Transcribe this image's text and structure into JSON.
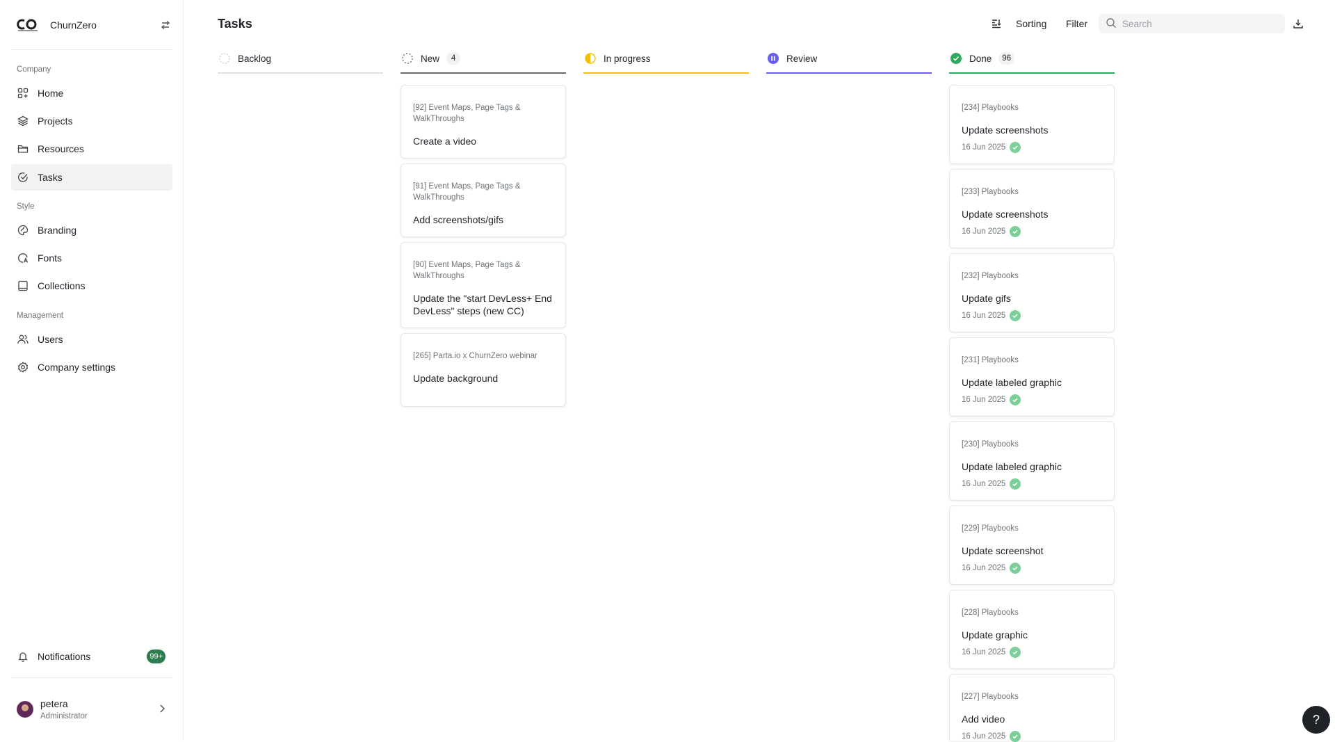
{
  "brand": {
    "name": "ChurnZero"
  },
  "sidebar": {
    "sections": {
      "company": "Company",
      "style": "Style",
      "management": "Management"
    },
    "items": [
      {
        "label": "Home",
        "icon": "home-icon"
      },
      {
        "label": "Projects",
        "icon": "stack-icon"
      },
      {
        "label": "Resources",
        "icon": "folder-icon"
      },
      {
        "label": "Tasks",
        "icon": "check-circle-icon",
        "active": true
      },
      {
        "label": "Branding",
        "icon": "palette-icon"
      },
      {
        "label": "Fonts",
        "icon": "font-icon"
      },
      {
        "label": "Collections",
        "icon": "book-icon"
      },
      {
        "label": "Users",
        "icon": "users-icon"
      },
      {
        "label": "Company settings",
        "icon": "gear-icon"
      }
    ],
    "notifications": {
      "label": "Notifications",
      "badge": "99+"
    },
    "user": {
      "name": "petera",
      "role": "Administrator"
    }
  },
  "header": {
    "title": "Tasks",
    "sorting_label": "Sorting",
    "filter_label": "Filter",
    "search_placeholder": "Search"
  },
  "columns": [
    {
      "name": "Backlog",
      "count": "",
      "color": "#e0e0e0"
    },
    {
      "name": "New",
      "count": "4",
      "color": "#6b6b6b"
    },
    {
      "name": "In progress",
      "count": "",
      "color": "#f0c000"
    },
    {
      "name": "Review",
      "count": "",
      "color": "#6b5cf0"
    },
    {
      "name": "Done",
      "count": "96",
      "color": "#2ea85a"
    }
  ],
  "new_cards": [
    {
      "project": "[92] Event Maps, Page Tags & WalkThroughs",
      "title": "Create a video"
    },
    {
      "project": "[91] Event Maps, Page Tags & WalkThroughs",
      "title": "Add screenshots/gifs"
    },
    {
      "project": "[90] Event Maps, Page Tags & WalkThroughs",
      "title": "Update the \"start DevLess+ End DevLess\" steps (new CC)"
    },
    {
      "project": "[265] Parta.io x ChurnZero webinar",
      "title": "Update background"
    }
  ],
  "done_cards": [
    {
      "project": "[234] Playbooks",
      "title": "Update screenshots",
      "date": "16 Jun 2025"
    },
    {
      "project": "[233] Playbooks",
      "title": "Update screenshots",
      "date": "16 Jun 2025"
    },
    {
      "project": "[232] Playbooks",
      "title": "Update gifs",
      "date": "16 Jun 2025"
    },
    {
      "project": "[231] Playbooks",
      "title": "Update labeled graphic",
      "date": "16 Jun 2025"
    },
    {
      "project": "[230] Playbooks",
      "title": "Update labeled graphic",
      "date": "16 Jun 2025"
    },
    {
      "project": "[229] Playbooks",
      "title": "Update screenshot",
      "date": "16 Jun 2025"
    },
    {
      "project": "[228] Playbooks",
      "title": "Update graphic",
      "date": "16 Jun 2025"
    },
    {
      "project": "[227] Playbooks",
      "title": "Add video",
      "date": "16 Jun 2025"
    }
  ],
  "help": {
    "label": "?"
  }
}
